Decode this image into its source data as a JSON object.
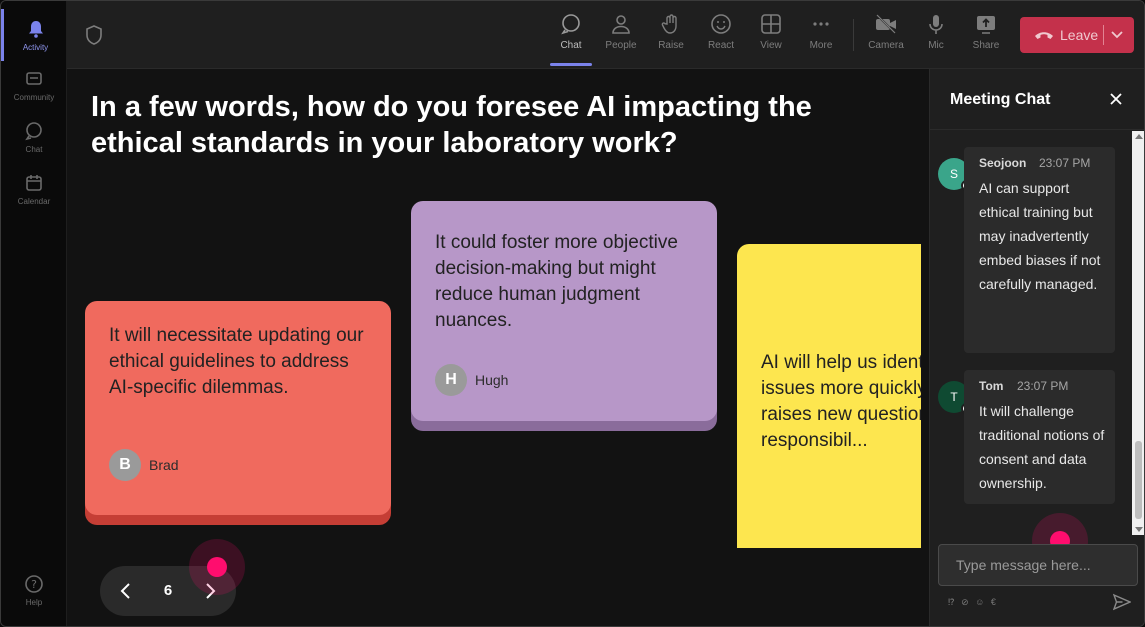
{
  "rail": {
    "items": [
      {
        "label": "Activity",
        "icon": "bell-icon",
        "active": true
      },
      {
        "label": "Community",
        "icon": "community-icon"
      },
      {
        "label": "Chat",
        "icon": "chat-bubble-icon"
      },
      {
        "label": "Calendar",
        "icon": "calendar-icon"
      }
    ],
    "help_label": "Help"
  },
  "toolbar": {
    "buttons": [
      {
        "label": "Chat",
        "icon": "chat-icon",
        "active": true
      },
      {
        "label": "People",
        "icon": "people-icon"
      },
      {
        "label": "Raise",
        "icon": "raise-hand-icon"
      },
      {
        "label": "React",
        "icon": "react-emoji-icon"
      },
      {
        "label": "View",
        "icon": "view-grid-icon"
      },
      {
        "label": "More",
        "icon": "more-dots-icon"
      },
      {
        "label": "Camera",
        "icon": "camera-icon"
      },
      {
        "label": "Mic",
        "icon": "mic-icon"
      },
      {
        "label": "Share",
        "icon": "share-icon"
      }
    ],
    "leave_label": "Leave"
  },
  "stage": {
    "question": "In a few words, how do you foresee AI impacting the ethical standards in your laboratory work?",
    "cards": [
      {
        "text": "It will necessitate updating our ethical guidelines to address AI-specific dilemmas.",
        "author": "Brad",
        "initial": "B",
        "color": "#f06a5e"
      },
      {
        "text": "It could foster more objective decision-making but might reduce human judgment nuances.",
        "author": "Hugh",
        "initial": "H",
        "color": "#b797c8"
      },
      {
        "text": "AI will help us identify issues more quickly raises new questions responsibil...",
        "color": "#fde64f"
      }
    ],
    "pager": {
      "page": "6"
    }
  },
  "chat": {
    "title": "Meeting Chat",
    "messages": [
      {
        "author": "Seojoon",
        "initial": "S",
        "time": "23:07 PM",
        "text": "AI can support ethical training but may inadvertently embed biases if not carefully managed.",
        "avatar_color": "#3aa58a"
      },
      {
        "author": "Tom",
        "initial": "T",
        "time": "23:07 PM",
        "text": "It will challenge traditional notions of consent and data ownership.",
        "avatar_color": "#0f4a32"
      }
    ],
    "compose_placeholder": "Type message here...",
    "tools_label": "⁉ ⊘ ☺ €"
  },
  "colors": {
    "accent": "#7b83eb",
    "leave": "#c4314b",
    "pointer": "#ff0d6e"
  }
}
